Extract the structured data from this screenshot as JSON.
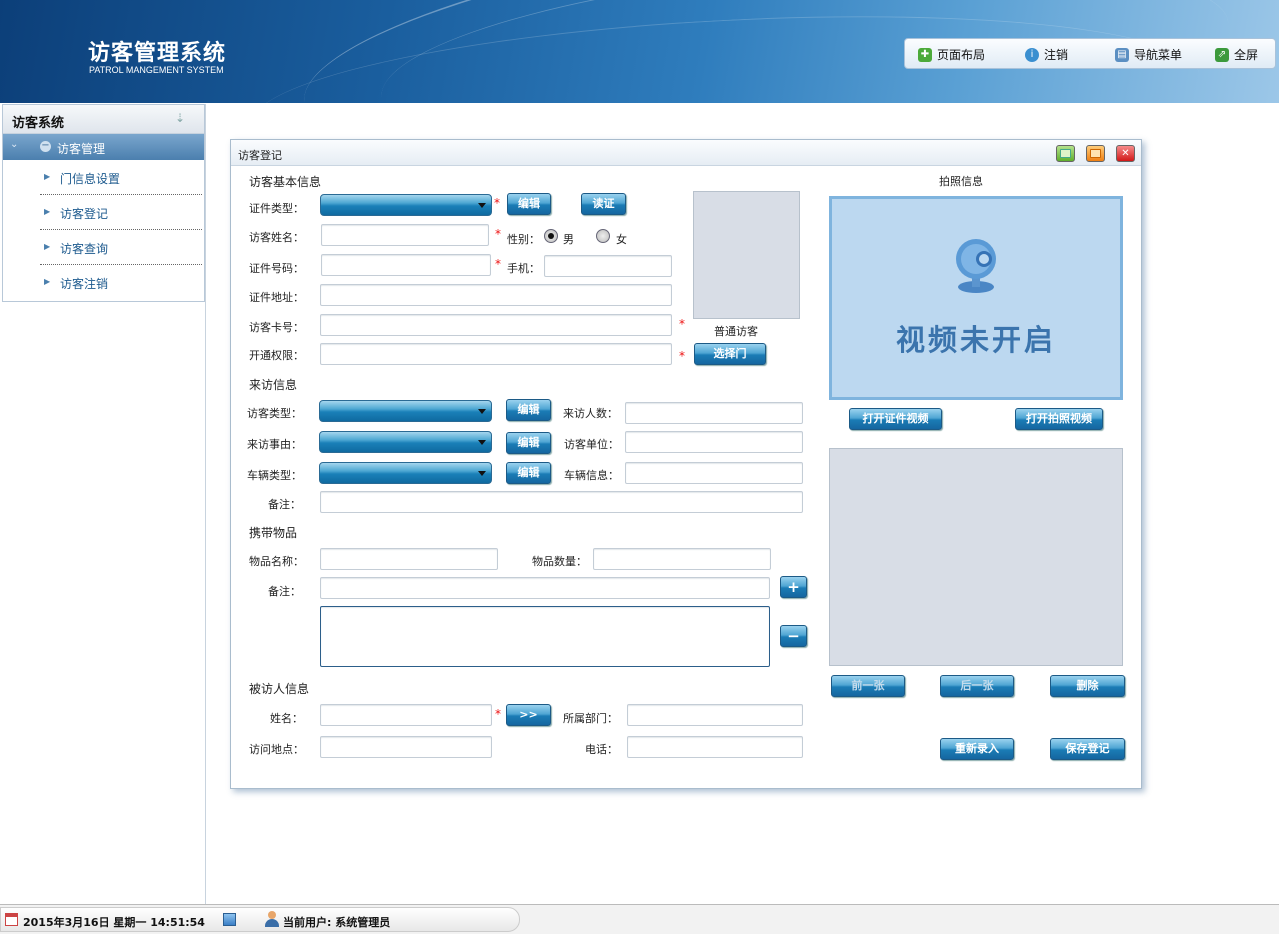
{
  "header": {
    "title": "访客管理系统",
    "subtitle": "PATROL MANGEMENT SYSTEM",
    "toolbar": {
      "layout": "页面布局",
      "logout": "注销",
      "nav_menu": "导航菜单",
      "fullscreen": "全屏"
    }
  },
  "sidebar": {
    "title": "访客系统",
    "group": "访客管理",
    "items": [
      {
        "label": "门信息设置"
      },
      {
        "label": "访客登记"
      },
      {
        "label": "访客查询"
      },
      {
        "label": "访客注销"
      }
    ]
  },
  "dialog": {
    "title": "访客登记",
    "basic": {
      "section": "访客基本信息",
      "id_type": "证件类型：",
      "edit": "编辑",
      "read_id": "读证",
      "name": "访客姓名：",
      "gender": "性别：",
      "male": "男",
      "female": "女",
      "id_number": "证件号码：",
      "phone": "手机：",
      "id_address": "证件地址：",
      "card_no": "访客卡号：",
      "permission": "开通权限：",
      "select_door": "选择门",
      "visitor_kind": "普通访客"
    },
    "visit": {
      "section": "来访信息",
      "visitor_type": "访客类型：",
      "edit": "编辑",
      "visitor_count": "来访人数：",
      "reason": "来访事由：",
      "visitor_unit": "访客单位：",
      "vehicle_type": "车辆类型：",
      "vehicle_info": "车辆信息：",
      "remark": "备注："
    },
    "items": {
      "section": "携带物品",
      "item_name": "物品名称：",
      "item_qty": "物品数量：",
      "remark": "备注：",
      "add": "+",
      "remove": "−"
    },
    "host": {
      "section": "被访人信息",
      "name": "姓名：",
      "pick": ">>",
      "department": "所属部门：",
      "location": "访问地点：",
      "phone": "电话："
    },
    "photo": {
      "section": "拍照信息",
      "video_status": "视频未开启",
      "open_id_video": "打开证件视频",
      "open_photo_video": "打开拍照视频",
      "prev": "前一张",
      "next": "后一张",
      "delete": "删除",
      "reenter": "重新录入",
      "save": "保存登记"
    }
  },
  "status": {
    "datetime": "2015年3月16日 星期一 14:51:54",
    "current_user": "当前用户: 系统管理员"
  }
}
